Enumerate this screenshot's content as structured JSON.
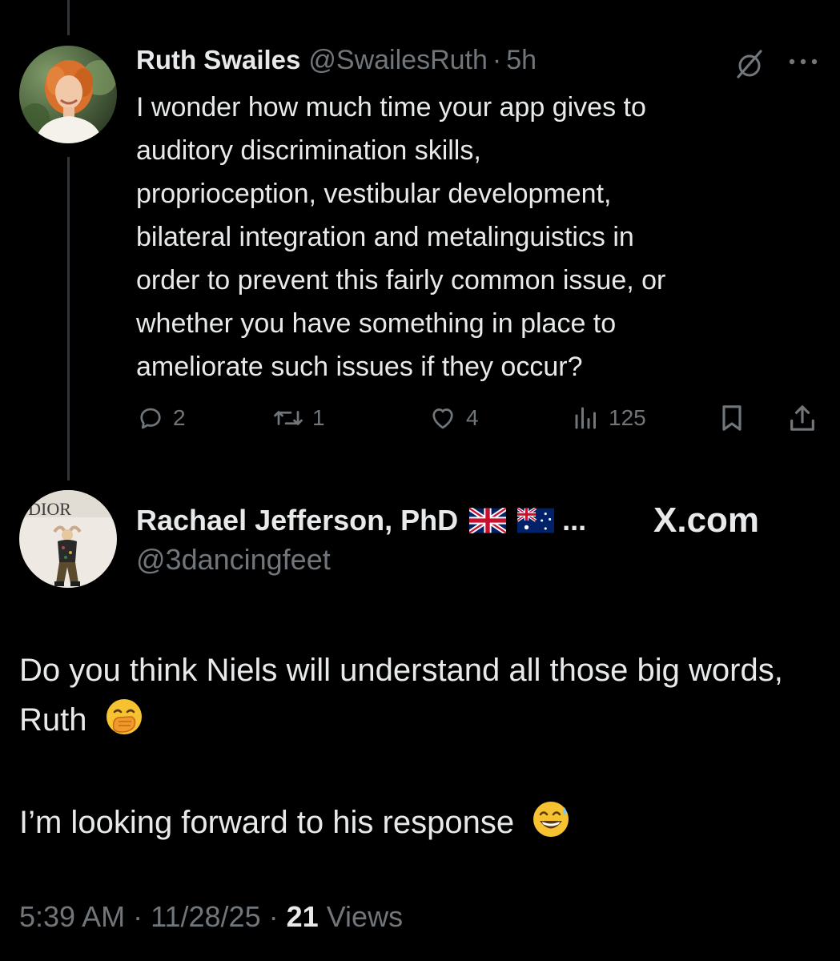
{
  "reply": {
    "author_name": "Ruth Swailes",
    "handle": "@SwailesRuth",
    "separator": "·",
    "time_ago": "5h",
    "text": "I wonder how much time your app gives to\nauditory discrimination skills,\nproprioception, vestibular development,\nbilateral integration and metalinguistics in\norder to prevent this fairly common issue, or\nwhether you have something in place to\nameliorate such issues if they occur?",
    "actions": {
      "replies": "2",
      "reposts": "1",
      "likes": "4",
      "views": "125"
    },
    "icons": [
      "grok-icon",
      "more-icon",
      "reply-icon",
      "repost-icon",
      "like-icon",
      "views-icon",
      "bookmark-icon",
      "share-icon"
    ]
  },
  "quote": {
    "author_name": "Rachael Jefferson, PhD",
    "flags": [
      "uk-flag",
      "australia-flag"
    ],
    "truncation": "...",
    "handle": "@3dancingfeet",
    "avatar_sign_text": "DIOR",
    "watermark": "X.com",
    "paragraphs": [
      "Do you think Niels will understand all those big words, Ruth",
      "I’m looking forward to his response"
    ],
    "paragraph_emojis": [
      "face-with-hand-over-mouth-emoji",
      "grinning-sweat-emoji"
    ]
  },
  "footer": {
    "time": "5:39 AM",
    "separator": "·",
    "date": "11/28/25",
    "views_count": "21",
    "views_label": "Views"
  },
  "colors": {
    "background": "#000000",
    "primary_text": "#e7e9ea",
    "secondary_text": "#71767b",
    "thread_line": "#333639"
  }
}
